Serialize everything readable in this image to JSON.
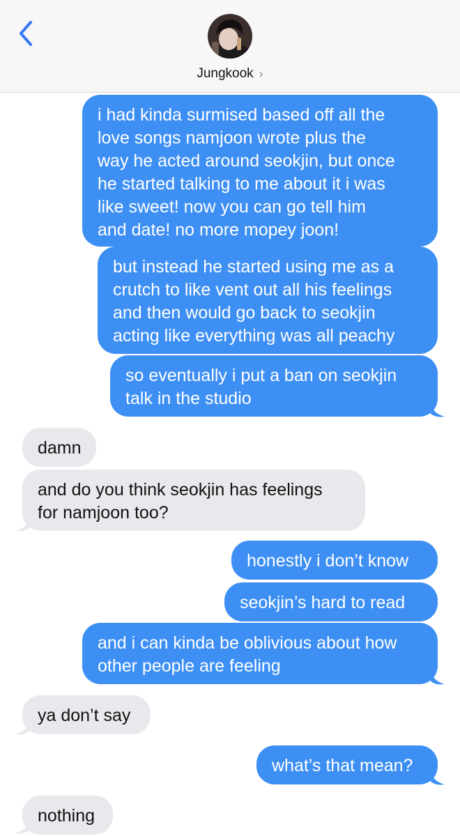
{
  "header": {
    "contact_name": "Jungkook",
    "chevron": "›",
    "back_icon": "chevron-left-icon",
    "accent_color": "#3478f6"
  },
  "messages": [
    {
      "side": "out",
      "lines": [
        "i had kinda surmised based off all the",
        "love songs namjoon wrote plus the",
        "way he acted around seokjin, but once",
        "he started talking to me about it i was",
        "like sweet! now you can go tell him",
        "and date! no more mopey joon!"
      ]
    },
    {
      "side": "out",
      "lines": [
        "but instead he started using me as a",
        "crutch to like vent out all his feelings",
        "and then would go back to seokjin",
        "acting like everything was all peachy"
      ]
    },
    {
      "side": "out",
      "lines": [
        "so eventually i put a ban on seokjin",
        "talk in the studio"
      ]
    },
    {
      "side": "in",
      "lines": [
        "damn"
      ]
    },
    {
      "side": "in",
      "lines": [
        "and do you think seokjin has feelings",
        "for namjoon too?"
      ]
    },
    {
      "side": "out",
      "lines": [
        "honestly i don’t know"
      ]
    },
    {
      "side": "out",
      "lines": [
        "seokjin’s hard to read"
      ]
    },
    {
      "side": "out",
      "lines": [
        "and i can kinda be oblivious about how",
        "other people are feeling"
      ]
    },
    {
      "side": "in",
      "lines": [
        "ya don’t say"
      ]
    },
    {
      "side": "out",
      "lines": [
        "what’s that mean?"
      ]
    },
    {
      "side": "in",
      "lines": [
        "nothing"
      ]
    }
  ],
  "colors": {
    "outgoing_bubble": "#3d8ff4",
    "incoming_bubble": "#e9e9ed"
  }
}
